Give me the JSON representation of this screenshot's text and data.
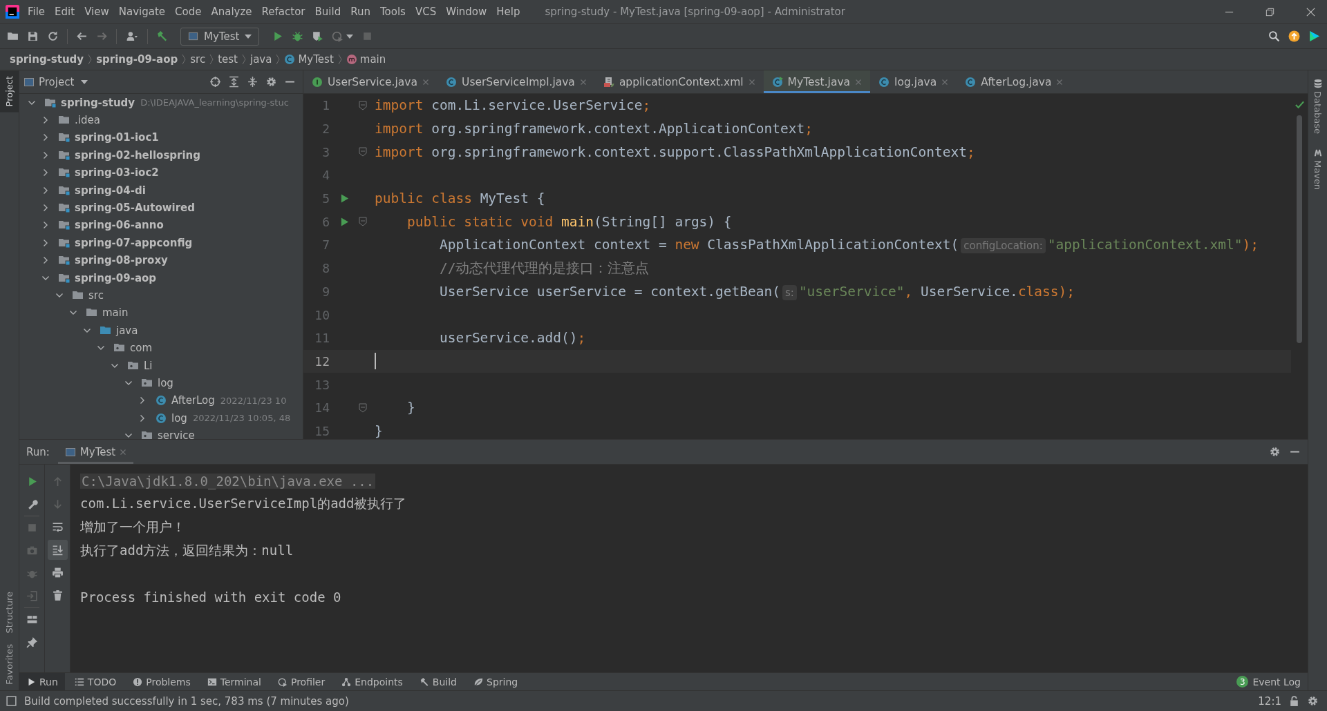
{
  "window": {
    "title": "spring-study - MyTest.java [spring-09-aop] - Administrator"
  },
  "menu": [
    "File",
    "Edit",
    "View",
    "Navigate",
    "Code",
    "Analyze",
    "Refactor",
    "Build",
    "Run",
    "Tools",
    "VCS",
    "Window",
    "Help"
  ],
  "toolbar": {
    "run_config": "MyTest"
  },
  "breadcrumb": [
    {
      "label": "spring-study",
      "kind": "module"
    },
    {
      "label": "spring-09-aop",
      "kind": "module"
    },
    {
      "label": "src",
      "kind": "folder"
    },
    {
      "label": "test",
      "kind": "folder"
    },
    {
      "label": "java",
      "kind": "folder"
    },
    {
      "label": "MyTest",
      "kind": "class"
    },
    {
      "label": "main",
      "kind": "method"
    }
  ],
  "left_strip": {
    "top": [
      {
        "label": "Project",
        "selected": true
      }
    ],
    "bottom": [
      {
        "label": "Structure",
        "selected": false
      },
      {
        "label": "Favorites",
        "selected": false
      }
    ]
  },
  "right_strip": [
    {
      "label": "Database",
      "kind": "database"
    },
    {
      "label": "Maven",
      "kind": "maven"
    }
  ],
  "project_panel": {
    "title": "Project",
    "tree": [
      {
        "label": "spring-study",
        "kind": "module",
        "expanded": true,
        "detail": "D:\\IDEAJAVA_learning\\spring-stuc",
        "children": [
          {
            "label": ".idea",
            "kind": "folder",
            "expanded": false
          },
          {
            "label": "spring-01-ioc1",
            "kind": "module",
            "expanded": false
          },
          {
            "label": "spring-02-hellospring",
            "kind": "module",
            "expanded": false
          },
          {
            "label": "spring-03-ioc2",
            "kind": "module",
            "expanded": false
          },
          {
            "label": "spring-04-di",
            "kind": "module",
            "expanded": false
          },
          {
            "label": "spring-05-Autowired",
            "kind": "module",
            "expanded": false
          },
          {
            "label": "spring-06-anno",
            "kind": "module",
            "expanded": false
          },
          {
            "label": "spring-07-appconfig",
            "kind": "module",
            "expanded": false
          },
          {
            "label": "spring-08-proxy",
            "kind": "module",
            "expanded": false
          },
          {
            "label": "spring-09-aop",
            "kind": "module",
            "expanded": true,
            "children": [
              {
                "label": "src",
                "kind": "folder",
                "expanded": true,
                "children": [
                  {
                    "label": "main",
                    "kind": "folder",
                    "expanded": true,
                    "children": [
                      {
                        "label": "java",
                        "kind": "source",
                        "expanded": true,
                        "children": [
                          {
                            "label": "com",
                            "kind": "package",
                            "expanded": true,
                            "children": [
                              {
                                "label": "Li",
                                "kind": "package",
                                "expanded": true,
                                "children": [
                                  {
                                    "label": "log",
                                    "kind": "package",
                                    "expanded": true,
                                    "children": [
                                      {
                                        "label": "AfterLog",
                                        "kind": "class",
                                        "expanded": false,
                                        "detail": "2022/11/23 10"
                                      },
                                      {
                                        "label": "log",
                                        "kind": "class",
                                        "expanded": false,
                                        "detail": "2022/11/23 10:05, 48"
                                      }
                                    ]
                                  },
                                  {
                                    "label": "service",
                                    "kind": "package",
                                    "expanded": true
                                  }
                                ]
                              }
                            ]
                          }
                        ]
                      }
                    ]
                  }
                ]
              }
            ]
          }
        ]
      }
    ]
  },
  "editor_tabs": [
    {
      "label": "UserService.java",
      "kind": "interface",
      "selected": false
    },
    {
      "label": "UserServiceImpl.java",
      "kind": "class",
      "selected": false
    },
    {
      "label": "applicationContext.xml",
      "kind": "xml",
      "selected": false
    },
    {
      "label": "MyTest.java",
      "kind": "test",
      "selected": true
    },
    {
      "label": "log.java",
      "kind": "class",
      "selected": false
    },
    {
      "label": "AfterLog.java",
      "kind": "class",
      "selected": false
    }
  ],
  "editor": {
    "lines": [
      {
        "number": "1",
        "current": false,
        "run": false,
        "fold": true,
        "tokens": [
          {
            "text": "import ",
            "kind": "keyword"
          },
          {
            "text": "com.Li.service.UserService",
            "kind": "identifier"
          },
          {
            "text": ";",
            "kind": "keyword"
          }
        ]
      },
      {
        "number": "2",
        "current": false,
        "run": false,
        "fold": false,
        "tokens": [
          {
            "text": "import ",
            "kind": "keyword"
          },
          {
            "text": "org.springframework.context.ApplicationContext",
            "kind": "identifier"
          },
          {
            "text": ";",
            "kind": "keyword"
          }
        ]
      },
      {
        "number": "3",
        "current": false,
        "run": false,
        "fold": true,
        "tokens": [
          {
            "text": "import ",
            "kind": "keyword"
          },
          {
            "text": "org.springframework.context.support.ClassPathXmlApplicationContext",
            "kind": "identifier"
          },
          {
            "text": ";",
            "kind": "keyword"
          }
        ]
      },
      {
        "number": "4",
        "current": false,
        "run": false,
        "fold": false
      },
      {
        "number": "5",
        "current": false,
        "run": true,
        "fold": false,
        "tokens": [
          {
            "text": "public class ",
            "kind": "keyword"
          },
          {
            "text": "MyTest {",
            "kind": "identifier"
          }
        ]
      },
      {
        "number": "6",
        "current": false,
        "run": true,
        "fold": true,
        "tokens": [
          {
            "text": "    public static void ",
            "kind": "keyword"
          },
          {
            "text": "main",
            "kind": "method"
          },
          {
            "text": "(String[] args) {",
            "kind": "identifier"
          }
        ]
      },
      {
        "number": "7",
        "current": false,
        "run": false,
        "fold": false,
        "tokens": [
          {
            "text": "        ApplicationContext context = ",
            "kind": "identifier"
          },
          {
            "text": "new ",
            "kind": "keyword"
          },
          {
            "text": "ClassPathXmlApplicationContext(",
            "kind": "identifier"
          },
          {
            "text": "configLocation:",
            "kind": "hint"
          },
          {
            "text": "\"applicationContext.xml\"",
            "kind": "string"
          },
          {
            "text": ");",
            "kind": "keyword"
          }
        ]
      },
      {
        "number": "8",
        "current": false,
        "run": false,
        "fold": false,
        "tokens": [
          {
            "text": "        //动态代理代理的是接口：注意点",
            "kind": "comment"
          }
        ]
      },
      {
        "number": "9",
        "current": false,
        "run": false,
        "fold": false,
        "tokens": [
          {
            "text": "        UserService userService = context.getBean(",
            "kind": "identifier"
          },
          {
            "text": "s:",
            "kind": "hint"
          },
          {
            "text": "\"userService\"",
            "kind": "string"
          },
          {
            "text": ", ",
            "kind": "keyword"
          },
          {
            "text": "UserService.",
            "kind": "identifier"
          },
          {
            "text": "class",
            "kind": "keyword"
          },
          {
            "text": ");",
            "kind": "keyword"
          }
        ]
      },
      {
        "number": "10",
        "current": false,
        "run": false,
        "fold": false
      },
      {
        "number": "11",
        "current": false,
        "run": false,
        "fold": false,
        "tokens": [
          {
            "text": "        userService.add()",
            "kind": "identifier"
          },
          {
            "text": ";",
            "kind": "keyword"
          }
        ]
      },
      {
        "number": "12",
        "current": true,
        "run": false,
        "fold": false
      },
      {
        "number": "13",
        "current": false,
        "run": false,
        "fold": false
      },
      {
        "number": "14",
        "current": false,
        "run": false,
        "fold": true,
        "tokens": [
          {
            "text": "    }",
            "kind": "identifier"
          }
        ]
      },
      {
        "number": "15",
        "current": false,
        "run": false,
        "fold": false,
        "tokens": [
          {
            "text": "}",
            "kind": "identifier"
          }
        ]
      }
    ]
  },
  "run_panel": {
    "label": "Run:",
    "tab": "MyTest",
    "output": [
      {
        "text": "C:\\Java\\jdk1.8.0_202\\bin\\java.exe ...",
        "kind": "command"
      },
      {
        "text": "com.Li.service.UserServiceImpl的add被执行了",
        "kind": "output"
      },
      {
        "text": "增加了一个用户！",
        "kind": "output"
      },
      {
        "text": "执行了add方法，返回结果为：null",
        "kind": "output"
      },
      {
        "text": "Process finished with exit code 0",
        "kind": "output"
      }
    ]
  },
  "tool_tabs": [
    {
      "label": "Run",
      "kind": "run",
      "selected": true
    },
    {
      "label": "TODO",
      "kind": "todo",
      "selected": false
    },
    {
      "label": "Problems",
      "kind": "problems",
      "selected": false
    },
    {
      "label": "Terminal",
      "kind": "terminal",
      "selected": false
    },
    {
      "label": "Profiler",
      "kind": "profiler",
      "selected": false
    },
    {
      "label": "Endpoints",
      "kind": "endpoints",
      "selected": false
    },
    {
      "label": "Build",
      "kind": "build",
      "selected": false
    },
    {
      "label": "Spring",
      "kind": "spring",
      "selected": false
    }
  ],
  "event_log": {
    "count": "3",
    "label": "Event Log"
  },
  "status_bar": {
    "message": "Build completed successfully in 1 sec, 783 ms (7 minutes ago)",
    "position": "12:1"
  }
}
